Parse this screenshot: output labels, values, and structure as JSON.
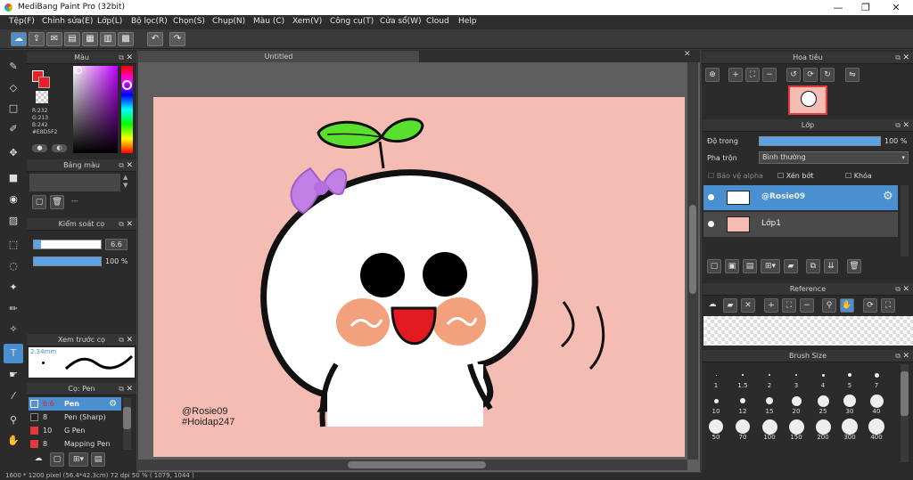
{
  "title": "MediBang Paint Pro (32bit)",
  "window_controls": [
    "—",
    "❐",
    "✕"
  ],
  "menu": [
    "Tệp(F)",
    "Chỉnh sửa(E)",
    "Lớp(L)",
    "Bộ lọc(R)",
    "Chọn(S)",
    "Chụp(N)",
    "Màu (C)",
    "Xem(V)",
    "Công cụ(T)",
    "Cửa sổ(W)",
    "Cloud",
    "Help"
  ],
  "canvas_tab": "Untitled",
  "color_panel": {
    "title": "Màu",
    "r": "R:232",
    "g": "G:213",
    "b": "B:242",
    "hex": "#E8D5F2",
    "fg": "#e8202a",
    "bg": "#ffffff"
  },
  "palette_panel": {
    "title": "Bảng màu",
    "none": "---"
  },
  "brush_control": {
    "title": "Kiểm soát cọ",
    "size": "6.6",
    "opacity": "100 %",
    "opacity_fill": 1.0
  },
  "brush_preview": {
    "title": "Xem trước cọ",
    "size": "2.34mm"
  },
  "brush_list": {
    "title": "Cọ: Pen",
    "items": [
      {
        "size": "6.6",
        "name": "Pen",
        "color": "#5b8fd1",
        "selected": true
      },
      {
        "size": "8",
        "name": "Pen (Sharp)",
        "color": "#222222",
        "selected": false
      },
      {
        "size": "10",
        "name": "G Pen",
        "color": "#e33b3b",
        "selected": false
      },
      {
        "size": "8",
        "name": "Mapping Pen",
        "color": "#e33b3b",
        "selected": false
      }
    ]
  },
  "navigator": {
    "title": "Hoa tiêu"
  },
  "layer_panel": {
    "title": "Lớp",
    "opacity_label": "Độ trong",
    "opacity_value": "100 %",
    "opacity_fill": 1.0,
    "blend_label": "Pha trộn",
    "blend_value": "Bình thường",
    "protect_alpha": "Bảo vệ alpha",
    "clipping": "Xén bớt",
    "lock": "Khóa",
    "layers": [
      {
        "name": "@Rosie09",
        "selected": true
      },
      {
        "name": "Lớp1",
        "selected": false
      }
    ]
  },
  "reference": {
    "title": "Reference"
  },
  "brush_size": {
    "title": "Brush Size",
    "sizes": [
      "1",
      "1.5",
      "2",
      "3",
      "4",
      "5",
      "7",
      "10",
      "12",
      "15",
      "20",
      "25",
      "30",
      "40",
      "50",
      "70",
      "100",
      "150",
      "200",
      "300",
      "400"
    ]
  },
  "canvas_text": {
    "line1": "@Rosie09",
    "line2": "#Hoidap247"
  },
  "status": "1600 * 1200 pixel   (56.4*42.3cm)   72 dpi   50 %   ( 1079, 1044 )"
}
